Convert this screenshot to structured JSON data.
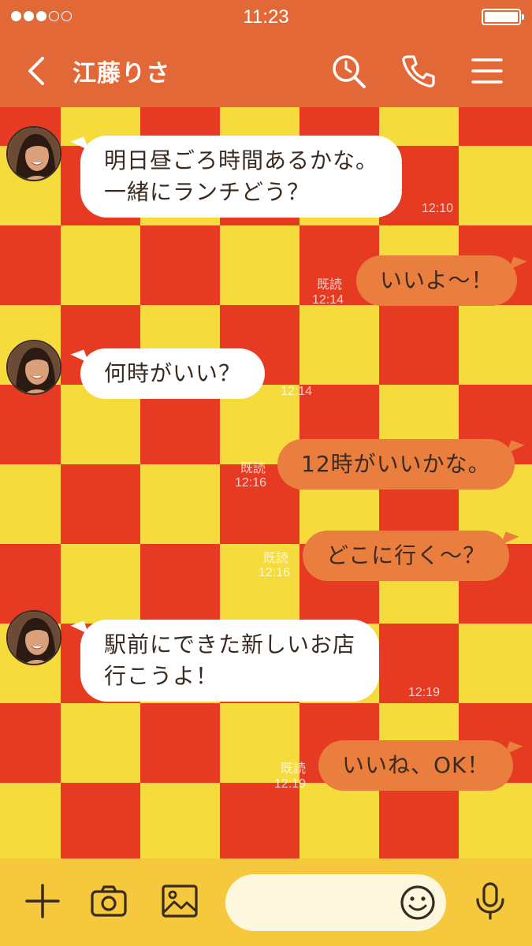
{
  "status_bar": {
    "time": "11:23",
    "signal_bars": [
      true,
      true,
      true,
      false,
      false
    ],
    "battery_level": 1.0
  },
  "header": {
    "title": "江藤りさ",
    "icons": [
      "back-icon",
      "search-icon",
      "phone-icon",
      "menu-icon"
    ]
  },
  "theme": {
    "header_color": "#e26838",
    "checker_red": "#e63a22",
    "checker_yellow": "#f5dc3c",
    "incoming_bubble": "#ffffff",
    "outgoing_bubble": "#e97e3e",
    "input_bar": "#f6c83e"
  },
  "messages": [
    {
      "side": "in",
      "lines": [
        "明日昼ごろ時間あるかな。",
        "一緒にランチどう？"
      ],
      "time": "12:10"
    },
    {
      "side": "out",
      "lines": [
        "いいよ〜！"
      ],
      "read": "既読",
      "time": "12:14"
    },
    {
      "side": "in",
      "lines": [
        "何時がいい？"
      ],
      "time": "12:14"
    },
    {
      "side": "out",
      "lines": [
        "12時がいいかな。"
      ],
      "read": "既読",
      "time": "12:16"
    },
    {
      "side": "out",
      "lines": [
        "どこに行く〜？"
      ],
      "read": "既読",
      "time": "12:16"
    },
    {
      "side": "in",
      "lines": [
        "駅前にできた新しいお店",
        "行こうよ！"
      ],
      "time": "12:19"
    },
    {
      "side": "out",
      "lines": [
        "いいね、OK！"
      ],
      "read": "既読",
      "time": "12:19"
    }
  ],
  "input_bar": {
    "placeholder": "",
    "icons": [
      "plus-icon",
      "camera-icon",
      "image-icon",
      "emoji-icon",
      "mic-icon"
    ]
  }
}
